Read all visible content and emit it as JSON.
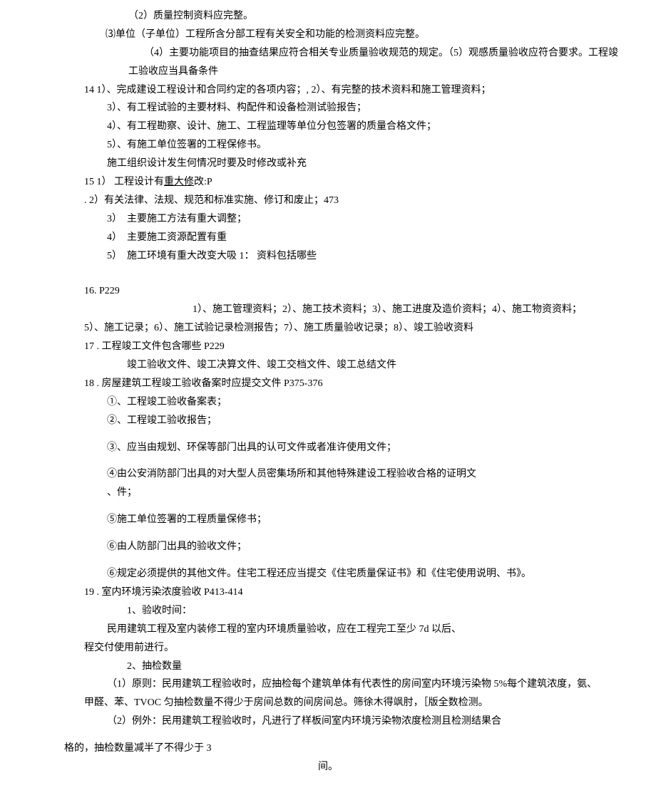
{
  "lines": {
    "l1": "（2）质量控制资料应完整。",
    "l2": "⑶单位（子单位）工程所含分部工程有关安全和功能的检测资料应完整。",
    "l3": "（4）主要功能项目的抽查结果应符合相关专业质量验收规范的规定。（5）观感质量验收应符合要求。工程竣",
    "l4": "工验收应当具备条件",
    "l5": "14 1）、完成建设工程设计和合同约定的各项内容；, 2）、有完整的技术资料和施工管理资料；",
    "l6": "3）、有工程试验的主要材料、构配件和设备检测试验报告；",
    "l7": "4）、有工程勘察、设计、施工、工程监理等单位分包签署的质量合格文件；",
    "l8": "5）、有施工单位签署的工程保修书。",
    "l9": "施工组织设计发生何情况时要及时修改或补充",
    "l10a": "15 1） 工程设计有",
    "l10b": "重大修",
    "l10c": "改:P",
    "l11": ". 2）有关法律、法规、规范和标准实施、修订和废止；473",
    "l12": "3）  主要施工方法有重大调整；",
    "l13": "4）  主要施工资源配置有重",
    "l14": "5）  施工环境有重大改变大吸 1： 资料包括哪些",
    "l15": "16. P229",
    "l16": "1）、施工管理资料；2）、施工技术资料；3）、施工进度及造价资料；4）、施工物资资料；",
    "l17": "5）、施工记录；6）、施工试验记录检测报告；7）、施工质量验收记录；8）、竣工验收资料",
    "l18": "17 . 工程竣工文件包含哪些 P229",
    "l19": "竣工验收文件、竣工决算文件、竣工交档文件、竣工总结文件",
    "l20": "18 . 房屋建筑工程竣工验收备案时应提交文件 P375-376",
    "l21": "①、工程竣工验收备案表；",
    "l22": "②、工程竣工验收报告；",
    "l23": "③、应当由规划、环保等部门出具的认可文件或者准许使用文件；",
    "l24": "④由公安消防部门出具的对大型人员密集场所和其他特殊建设工程验收合格的证明文",
    "l25": "、件；",
    "l26": "⑤施工单位签署的工程质量保修书；",
    "l27": "⑥由人防部门出具的验收文件；",
    "l28": "⑥规定必须提供的其他文件。住宅工程还应当提交《住宅质量保证书》和《住宅使用说明、书》。",
    "l29": "19 . 室内环境污染浓度验收 P413-414",
    "l30": "1、验收时间：",
    "l31": "民用建筑工程及室内装修工程的室内环境质量验收，应在工程完工至少 7d 以后、",
    "l32": "程交付使用前进行。",
    "l33": "2、抽检数量",
    "l34": "（1）原则：民用建筑工程验收时，应抽检每个建筑单体有代表性的房间室内环境污染物 5%每个建筑浓度，氨、",
    "l35": "甲醛、苯、TVOC 匀抽检数量不得少于房间总数的间房间总。筛徐木得飒肘，［版全数检测。",
    "l36": "（2）例外：民用建筑工程验收时，凡进行了样板间室内环境污染物浓度检测且检测结果合",
    "l37": "格的，抽检数量减半了不得少于 3",
    "l38": "间。"
  }
}
